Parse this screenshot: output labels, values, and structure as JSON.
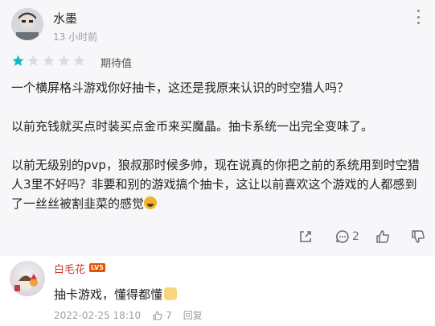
{
  "post": {
    "username": "水墨",
    "time_ago": "13 小时前",
    "rating": 1,
    "rating_max": 5,
    "rating_label": "期待值",
    "star_color_active": "#14b8c5",
    "star_color_inactive": "#d9dde1",
    "paragraphs": [
      "一个横屏格斗游戏你好抽卡，这还是我原来认识的时空猎人吗？",
      "以前充钱就买点时装买点金币来买魔晶。抽卡系统一出完全变味了。",
      "以前无级别的pvp，狼叔那时候多帅，现在说真的你把之前的系统用到时空猎人3里不好吗？非要和别的游戏搞个抽卡，这让以前喜欢这个游戏的人都感到了一丝丝被割韭菜的感觉"
    ],
    "actions": {
      "share_icon": "share-icon",
      "comment_icon": "comment-icon",
      "comment_count": "2",
      "like_icon": "thumbs-up-icon",
      "dislike_icon": "thumbs-down-icon"
    }
  },
  "reply": {
    "username": "白毛花",
    "level_badge": "LV5",
    "text": "抽卡游戏，懂得都懂",
    "date": "2022-02-25 18:10",
    "like_count": "7",
    "reply_label": "回复",
    "name_color": "#c0392b"
  }
}
